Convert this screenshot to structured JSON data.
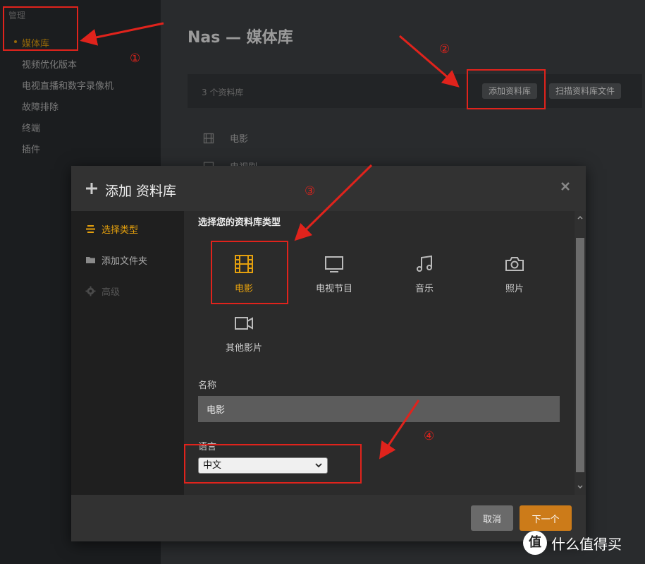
{
  "sidebar": {
    "section_title": "管理",
    "items": [
      {
        "label": "媒体库",
        "active": true
      },
      {
        "label": "视频优化版本"
      },
      {
        "label": "电视直播和数字录像机"
      },
      {
        "label": "故障排除"
      },
      {
        "label": "终端"
      },
      {
        "label": "插件"
      }
    ]
  },
  "main": {
    "title": "Nas — 媒体库",
    "library_count": "3 个资料库",
    "add_library_button": "添加资料库",
    "scan_library_button": "扫描资料库文件",
    "libraries": [
      {
        "label": "电影",
        "icon": "film-icon"
      },
      {
        "label": "电视剧",
        "icon": "tv-icon"
      }
    ]
  },
  "modal": {
    "title": "添加 资料库",
    "steps": [
      {
        "label": "选择类型",
        "icon": "list-icon",
        "state": "active"
      },
      {
        "label": "添加文件夹",
        "icon": "folder-icon",
        "state": "normal"
      },
      {
        "label": "高级",
        "icon": "gear-icon",
        "state": "disabled"
      }
    ],
    "heading": "选择您的资料库类型",
    "types": [
      {
        "label": "电影",
        "icon": "film-icon",
        "selected": true
      },
      {
        "label": "电视节目",
        "icon": "tv-icon"
      },
      {
        "label": "音乐",
        "icon": "music-icon"
      },
      {
        "label": "照片",
        "icon": "camera-icon"
      },
      {
        "label": "其他影片",
        "icon": "video-camera-icon"
      }
    ],
    "name_label": "名称",
    "name_value": "电影",
    "language_label": "语言",
    "language_value": "中文",
    "cancel_label": "取消",
    "next_label": "下一个"
  },
  "annotations": [
    "①",
    "②",
    "③",
    "④"
  ],
  "watermark": {
    "logo_text": "值",
    "text": "什么值得买"
  },
  "colors": {
    "accent": "#e5a00d",
    "annotation": "#e0231c",
    "next_button": "#cc7b19"
  }
}
